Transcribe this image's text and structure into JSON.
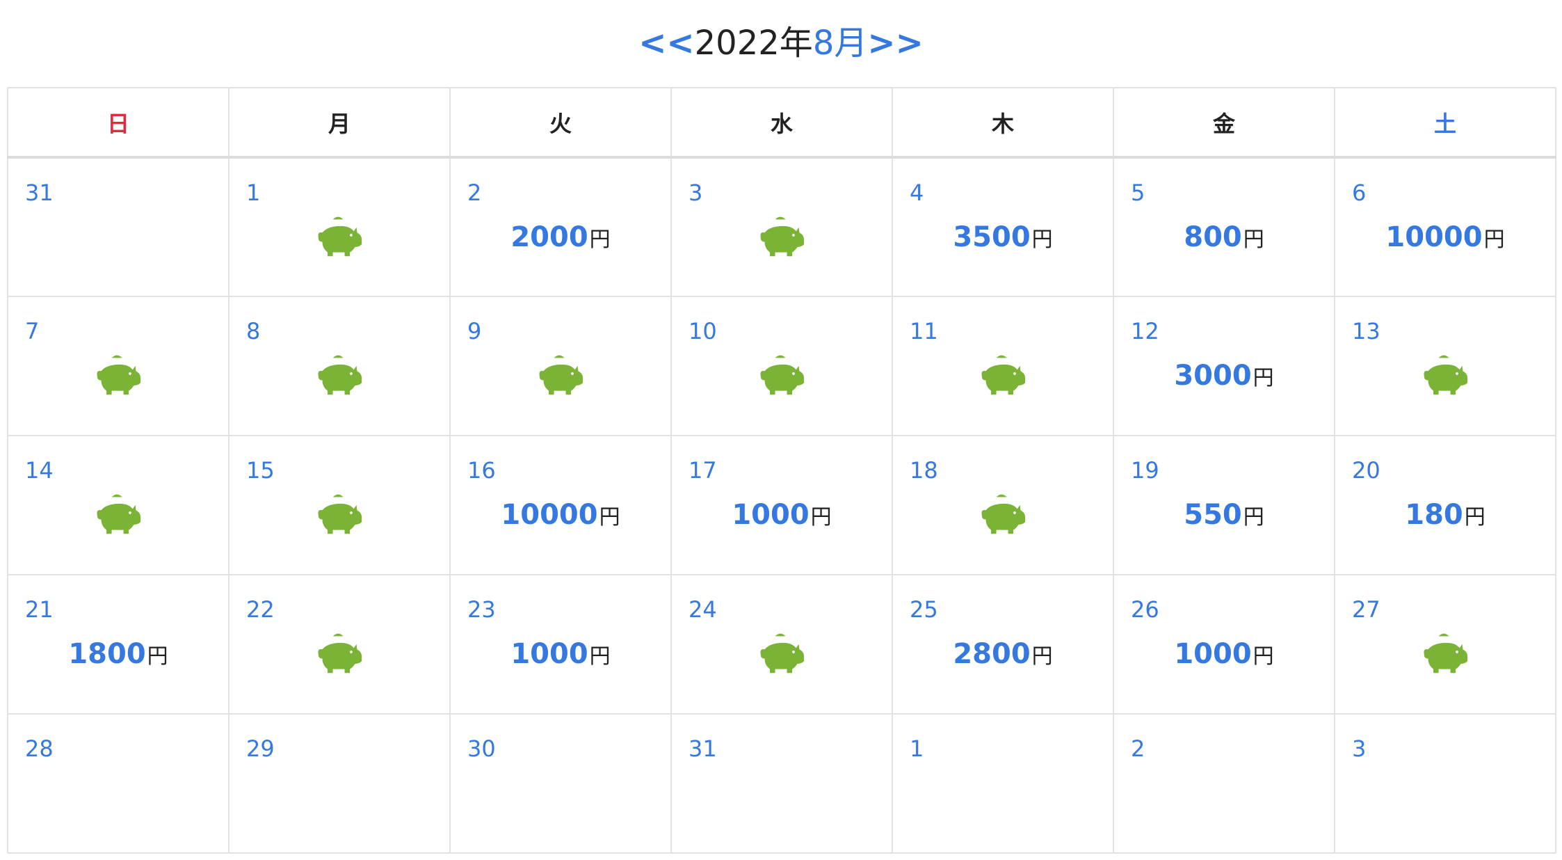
{
  "header": {
    "prev": "<<",
    "year": "2022年",
    "month": "8月",
    "next": ">>"
  },
  "weekdays": [
    "日",
    "月",
    "火",
    "水",
    "木",
    "金",
    "土"
  ],
  "yen_unit": "円",
  "icon_color": "#7ab335",
  "weeks": [
    [
      {
        "day": "31",
        "type": "other",
        "amount": null,
        "pig": false
      },
      {
        "day": "1",
        "type": "",
        "amount": null,
        "pig": true
      },
      {
        "day": "2",
        "type": "",
        "amount": "2000",
        "pig": false
      },
      {
        "day": "3",
        "type": "",
        "amount": null,
        "pig": true
      },
      {
        "day": "4",
        "type": "",
        "amount": "3500",
        "pig": false
      },
      {
        "day": "5",
        "type": "",
        "amount": "800",
        "pig": false
      },
      {
        "day": "6",
        "type": "sat",
        "amount": "10000",
        "pig": false
      }
    ],
    [
      {
        "day": "7",
        "type": "sun",
        "amount": null,
        "pig": true
      },
      {
        "day": "8",
        "type": "",
        "amount": null,
        "pig": true
      },
      {
        "day": "9",
        "type": "",
        "amount": null,
        "pig": true
      },
      {
        "day": "10",
        "type": "",
        "amount": null,
        "pig": true
      },
      {
        "day": "11",
        "type": "",
        "amount": null,
        "pig": true
      },
      {
        "day": "12",
        "type": "",
        "amount": "3000",
        "pig": false
      },
      {
        "day": "13",
        "type": "sat",
        "amount": null,
        "pig": true
      }
    ],
    [
      {
        "day": "14",
        "type": "sun",
        "amount": null,
        "pig": true
      },
      {
        "day": "15",
        "type": "",
        "amount": null,
        "pig": true
      },
      {
        "day": "16",
        "type": "",
        "amount": "10000",
        "pig": false
      },
      {
        "day": "17",
        "type": "",
        "amount": "1000",
        "pig": false
      },
      {
        "day": "18",
        "type": "",
        "amount": null,
        "pig": true
      },
      {
        "day": "19",
        "type": "",
        "amount": "550",
        "pig": false
      },
      {
        "day": "20",
        "type": "sat",
        "amount": "180",
        "pig": false
      }
    ],
    [
      {
        "day": "21",
        "type": "sun",
        "amount": "1800",
        "pig": false
      },
      {
        "day": "22",
        "type": "",
        "amount": null,
        "pig": true
      },
      {
        "day": "23",
        "type": "",
        "amount": "1000",
        "pig": false
      },
      {
        "day": "24",
        "type": "",
        "amount": null,
        "pig": true
      },
      {
        "day": "25",
        "type": "",
        "amount": "2800",
        "pig": false
      },
      {
        "day": "26",
        "type": "today",
        "amount": "1000",
        "pig": false
      },
      {
        "day": "27",
        "type": "sat",
        "amount": null,
        "pig": true
      }
    ],
    [
      {
        "day": "28",
        "type": "sun",
        "amount": null,
        "pig": false
      },
      {
        "day": "29",
        "type": "",
        "amount": null,
        "pig": false
      },
      {
        "day": "30",
        "type": "",
        "amount": null,
        "pig": false
      },
      {
        "day": "31",
        "type": "",
        "amount": null,
        "pig": false
      },
      {
        "day": "1",
        "type": "other",
        "amount": null,
        "pig": false
      },
      {
        "day": "2",
        "type": "other",
        "amount": null,
        "pig": false
      },
      {
        "day": "3",
        "type": "other",
        "amount": null,
        "pig": false
      }
    ]
  ]
}
